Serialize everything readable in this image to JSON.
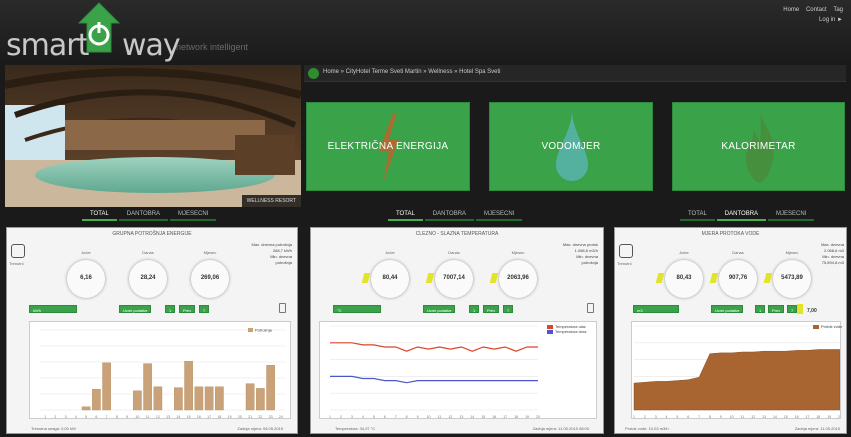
{
  "header": {
    "brand_left": "smart",
    "brand_right": "way",
    "tagline": "network intelligent",
    "links": [
      "Home",
      "Contact",
      "Tag"
    ],
    "logout": "Log in ►"
  },
  "hero": {
    "caption": "WELLNESS RESORT"
  },
  "breadcrumb": {
    "text": "Home » CityHotel Terme Sveti Martin » Wellness » Hotel Spa Sveti"
  },
  "tiles": [
    {
      "label": "ELEKTRIČNA ENERGIJA",
      "icon": "lightning-icon"
    },
    {
      "label": "VODOMJER",
      "icon": "water-drop-icon"
    },
    {
      "label": "KALORIMETAR",
      "icon": "flame-icon"
    }
  ],
  "tabs": [
    "TOTAL",
    "DANTOBRA",
    "MJESECNI"
  ],
  "panels": [
    {
      "title": "GRUPNA POTROŠNJA ENERGIJE",
      "meter_caption": "Trenutni",
      "gauges": [
        {
          "label": "Jučer",
          "value": "6,16"
        },
        {
          "label": "Danas",
          "value": "28,24"
        },
        {
          "label": "Mjesec",
          "value": "269,06"
        }
      ],
      "info": [
        "Max. dnevna potrošnja",
        "268,7 kWh",
        "Min. dnevna",
        "potrošnja"
      ],
      "controls": {
        "select": "kWh",
        "select2": "Uzmi podatke",
        "b1": "1",
        "b2": "Prev",
        "b3": "7"
      },
      "footer_left": "Trenutna snaga: 0,00 kW",
      "footer_right": "Zadnja mjera: 08.05.2015"
    },
    {
      "title": "CLEZNO - SLAZNA TEMPERATURA",
      "meter_caption": "Trenutni",
      "gauges": [
        {
          "label": "Jučer",
          "value": "80,44"
        },
        {
          "label": "Danas",
          "value": "7007,14"
        },
        {
          "label": "Mjesec",
          "value": "2063,96"
        }
      ],
      "info": [
        "Max. dnevna protok",
        "1.068,6 m3/h",
        "Min. dnevna",
        "potrošnja"
      ],
      "controls": {
        "select": "°C",
        "select2": "Uzmi podatke",
        "b1": "1",
        "b2": "Prev",
        "b3": "7"
      },
      "legend": [
        "Temperatura ulaz",
        "Temperatura izlaz"
      ],
      "footer_left": "Temperatura: 34,97 °C",
      "footer_right": "Zadnja mjera: 11.05.2015 08:00"
    },
    {
      "title": "MJERA PROTOKA VODE",
      "meter_caption": "Trenutni",
      "gauges": [
        {
          "label": "Jučer",
          "value": "80,43"
        },
        {
          "label": "Danas",
          "value": "907,76"
        },
        {
          "label": "Mjesec",
          "value": "5473,89"
        }
      ],
      "info": [
        "Max. dnevna",
        "2.068,6 m3",
        "Min. dnevna",
        "75,894,8 m3"
      ],
      "controls": {
        "select": "m3",
        "select2": "Uzmi podatke",
        "b1": "1",
        "b2": "Prev",
        "b3": "7"
      },
      "extra_value": "7,00",
      "legend": [
        "Protok vode"
      ],
      "footer_left": "Protok vode: 10,03 m3/h",
      "footer_right": "Zadnja mjera: 11.05.2015"
    }
  ],
  "colors": {
    "green": "#3aa34a",
    "bar": "#c9a27a",
    "line_red": "#d9472b",
    "line_blue": "#4b58c8",
    "area": "#a86532"
  },
  "chart_data": [
    {
      "type": "bar",
      "categories": [
        "1",
        "2",
        "3",
        "4",
        "5",
        "6",
        "7",
        "8",
        "9",
        "10",
        "11",
        "12",
        "13",
        "14",
        "15",
        "16",
        "17",
        "18",
        "19",
        "20",
        "21",
        "22",
        "23",
        "24"
      ],
      "values": [
        0,
        0,
        0,
        0,
        0.4,
        2.6,
        5.9,
        0,
        0,
        2.4,
        5.8,
        2.9,
        0,
        2.8,
        6.1,
        2.9,
        2.9,
        2.9,
        0,
        0,
        3.3,
        2.7,
        5.6,
        0
      ],
      "ylim": [
        0,
        10
      ],
      "xlabel": "",
      "ylabel": "",
      "legend": [
        "Potrošnja"
      ]
    },
    {
      "type": "line",
      "x": [
        1,
        2,
        3,
        4,
        5,
        6,
        7,
        8,
        9,
        10,
        11,
        12,
        13,
        14,
        15,
        16,
        17,
        18,
        19,
        20
      ],
      "series": [
        {
          "name": "Temperatura ulaz",
          "values": [
            41,
            41,
            41,
            40.5,
            40.5,
            40,
            40,
            39,
            40,
            39.5,
            40,
            39.5,
            40,
            39,
            40,
            39.5,
            40,
            39,
            40,
            40
          ]
        },
        {
          "name": "Temperatura izlaz",
          "values": [
            33,
            33,
            33,
            32.5,
            32.5,
            32,
            32,
            31.5,
            32,
            32,
            32,
            32,
            32,
            32,
            32,
            32,
            32,
            32,
            32,
            32
          ]
        }
      ],
      "ylim": [
        25,
        45
      ],
      "xlabel": "",
      "ylabel": ""
    },
    {
      "type": "area",
      "x": [
        1,
        2,
        3,
        4,
        5,
        6,
        7,
        8,
        9,
        10,
        11,
        12,
        13,
        14,
        15,
        16,
        17,
        18,
        19,
        20
      ],
      "series": [
        {
          "name": "Protok vode",
          "values": [
            3.2,
            3.3,
            3.4,
            3.4,
            3.5,
            3.6,
            3.9,
            6.7,
            6.8,
            6.8,
            6.9,
            6.9,
            7.0,
            7.0,
            7.0,
            7.1,
            7.1,
            7.2,
            7.2,
            7.2
          ]
        }
      ],
      "ylim": [
        0,
        10
      ],
      "xlabel": "",
      "ylabel": ""
    }
  ]
}
